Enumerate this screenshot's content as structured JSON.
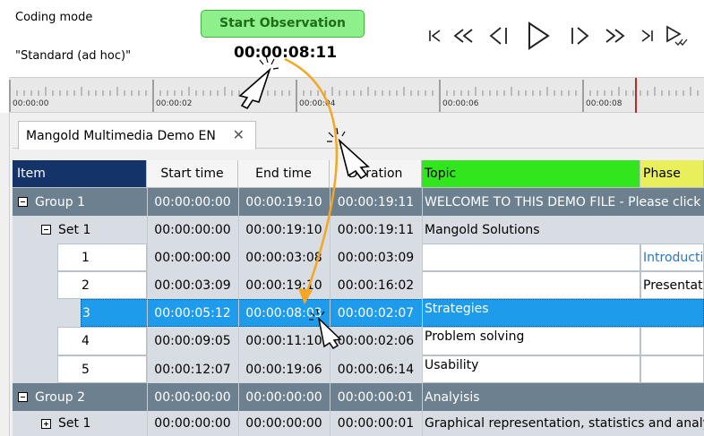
{
  "header": {
    "coding_mode_label": "Coding mode",
    "coding_mode_value": "\"Standard (ad hoc)\"",
    "start_button": "Start Observation",
    "timer": "00:00:08:11"
  },
  "ruler": {
    "ticks": [
      "00:00:00",
      "00:00:02",
      "00:00:04",
      "00:00:06",
      "00:00:08"
    ],
    "playhead_color": "#c0272d"
  },
  "tab": {
    "label": "Mangold Multimedia Demo EN",
    "close": "✕"
  },
  "grid": {
    "columns": {
      "item": "Item",
      "start": "Start time",
      "end": "End time",
      "duration": "Duration",
      "topic": "Topic",
      "phase": "Phase"
    },
    "colors": {
      "item": "#143369",
      "topic": "#32e61e",
      "phase": "#e8ef5a",
      "selected": "#1e9bea",
      "group": "#6c8090"
    },
    "rows": [
      {
        "label": "Group  1",
        "start": "00:00:00:00",
        "end": "00:00:19:10",
        "duration": "00:00:19:11",
        "topic": "WELCOME TO THIS DEMO FILE - Please click here",
        "phase": ""
      },
      {
        "label": "Set  1",
        "start": "00:00:00:00",
        "end": "00:00:19:10",
        "duration": "00:00:19:11",
        "topic": "Mangold Solutions",
        "phase": ""
      },
      {
        "label": "1",
        "start": "00:00:00:00",
        "end": "00:00:03:08",
        "duration": "00:00:03:09",
        "topic": "",
        "phase": "Introduction"
      },
      {
        "label": "2",
        "start": "00:00:03:09",
        "end": "00:00:19:10",
        "duration": "00:00:16:02",
        "topic": "",
        "phase": "Presentation"
      },
      {
        "label": "3",
        "start": "00:00:05:12",
        "end": "00:00:08:03",
        "duration": "00:00:02:07",
        "topic": "Strategies",
        "phase": ""
      },
      {
        "label": "4",
        "start": "00:00:09:05",
        "end": "00:00:11:10",
        "duration": "00:00:02:06",
        "topic": "Problem solving",
        "phase": ""
      },
      {
        "label": "5",
        "start": "00:00:12:07",
        "end": "00:00:19:06",
        "duration": "00:00:06:14",
        "topic": "Usability",
        "phase": ""
      },
      {
        "label": "Group  2",
        "start": "00:00:00:00",
        "end": "00:00:00:00",
        "duration": "00:00:00:01",
        "topic": "Analyisis",
        "phase": ""
      },
      {
        "label": "Set  1",
        "start": "00:00:00:00",
        "end": "00:00:00:00",
        "duration": "00:00:00:01",
        "topic": "Graphical representation, statistics and analysis",
        "phase": ""
      }
    ]
  },
  "annotation": {
    "arrow_color": "#f5a623"
  }
}
